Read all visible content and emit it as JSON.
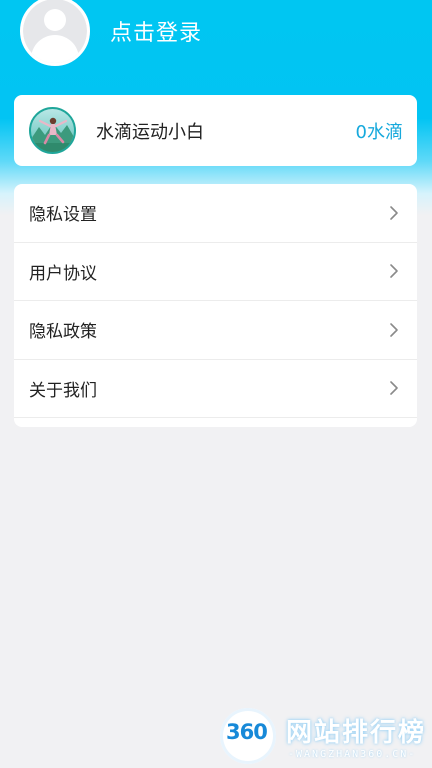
{
  "header": {
    "login_label": "点击登录"
  },
  "user_card": {
    "title": "水滴运动小白",
    "points": "0水滴"
  },
  "menu": {
    "items": [
      {
        "label": "隐私设置"
      },
      {
        "label": "用户协议"
      },
      {
        "label": "隐私政策"
      },
      {
        "label": "关于我们"
      }
    ]
  },
  "watermark": {
    "logo_number": "360",
    "title": "网站排行榜",
    "subtitle": "-WANGZHAN360.CN-"
  },
  "colors": {
    "header_accent": "#00c6f2",
    "points_color": "#17a9dc"
  },
  "icons": {
    "avatar": "default-avatar-icon",
    "level": "yoga-level-icon",
    "chevron": "chevron-right-icon"
  }
}
